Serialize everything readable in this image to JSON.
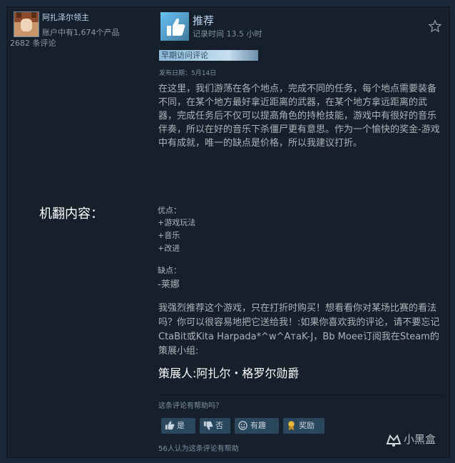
{
  "author": {
    "name": "阿扎泽尔领主",
    "products": "账户中有1,674个产品",
    "reviews": "2682 条评论"
  },
  "review": {
    "verdict": "推荐",
    "hours": "记录时间 13.5 小时",
    "early_access": "早期访问评论",
    "posted": "发布日期：5月14日",
    "body": "在这里，我们游荡在各个地点，完成不同的任务，每个地点需要装备不同，在某个地方最好拿近距离的武器，在某个地方拿远距离的武器，完成任务后不仅可以提高角色的持枪技能，游戏中有很好的音乐伴奏，所以在好的音乐下杀僵尸更有意思。作为一个愉快的奖金-游戏中有成就，唯一的缺点是价格，所以我建议打折。",
    "pros_label": "优点：",
    "pros": [
      "+游戏玩法",
      "+音乐",
      "+改进"
    ],
    "cons_label": "缺点：",
    "cons": [
      "-莱娜"
    ],
    "paragraph2": "我强烈推荐这个游戏，只在打折时购买！想看看你对某场比赛的看法吗？你可以很容易地把它送给我！:如果你喜欢我的评论，请不要忘记CtaBit或Kita Harpada*^w^AтaK-J，Bb Moee订阅我在Steam的策展小组:",
    "curator": "策展人:阿扎尔・格罗尔勋爵"
  },
  "annotation": "机翻内容：",
  "helpful": {
    "question": "这条评论有帮助吗？",
    "yes": "是",
    "no": "否",
    "funny": "有趣",
    "award": "奖励",
    "count": "56人认为这条评论有帮助"
  },
  "watermark": {
    "text": "小黑盒"
  },
  "colors": {
    "background": "#1b2838",
    "panel": "#16202d",
    "accent": "#67c1f5",
    "button": "#2a475e"
  }
}
